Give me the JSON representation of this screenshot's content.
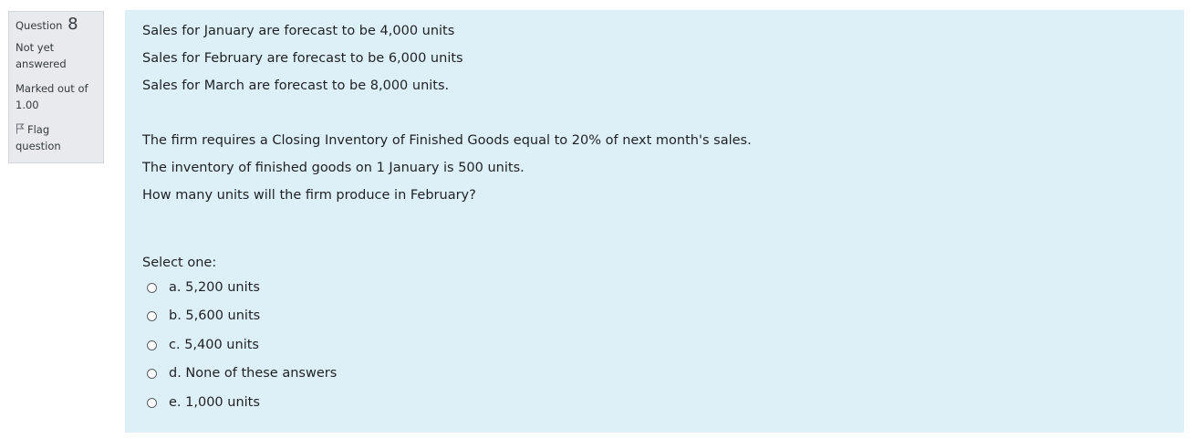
{
  "info": {
    "question_label": "Question",
    "question_number": "8",
    "state": "Not yet answered",
    "grade": "Marked out of 1.00",
    "flag_label": "Flag question",
    "flag_icon": "flag-icon"
  },
  "question": {
    "lines": [
      "Sales for January are forecast to be 4,000 units",
      "Sales for February are forecast to be 6,000 units",
      "Sales for March are forecast to be 8,000 units.",
      "The firm requires a Closing Inventory of Finished Goods equal to 20% of next month's sales.",
      "The inventory of finished goods on 1 January is 500 units.",
      "How many units will the firm produce in February?"
    ],
    "prompt": "Select one:",
    "options": [
      "a. 5,200 units",
      "b. 5,600 units",
      "c. 5,400 units",
      "d. None of these answers",
      "e. 1,000 units"
    ]
  },
  "colors": {
    "content_background": "#def0f7",
    "info_background": "#e8eaed",
    "text": "#1d2125"
  }
}
